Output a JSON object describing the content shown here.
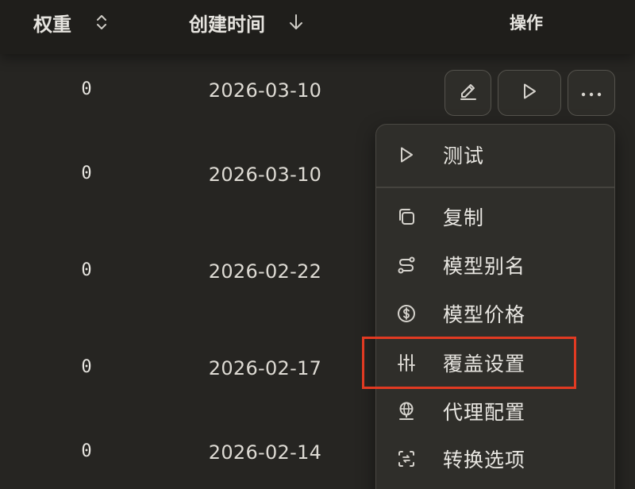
{
  "header": {
    "weight_label": "权重",
    "created_label": "创建时间",
    "ops_label": "操作"
  },
  "rows": [
    {
      "weight": "0",
      "created": "2026-03-10"
    },
    {
      "weight": "0",
      "created": "2026-03-10"
    },
    {
      "weight": "0",
      "created": "2026-02-22"
    },
    {
      "weight": "0",
      "created": "2026-02-17"
    },
    {
      "weight": "0",
      "created": "2026-02-14"
    }
  ],
  "actions": {
    "edit_icon": "pencil-icon",
    "test_icon": "play-icon",
    "more_icon": "more-horizontal-icon"
  },
  "menu": {
    "items": [
      {
        "label": "测试",
        "icon": "play-icon"
      },
      {
        "label": "复制",
        "icon": "copy-icon"
      },
      {
        "label": "模型别名",
        "icon": "route-icon"
      },
      {
        "label": "模型价格",
        "icon": "dollar-circle-icon"
      },
      {
        "label": "覆盖设置",
        "icon": "sliders-icon",
        "highlighted": true
      },
      {
        "label": "代理配置",
        "icon": "globe-pin-icon"
      },
      {
        "label": "转换选项",
        "icon": "convert-icon"
      }
    ]
  },
  "colors": {
    "background": "#262522",
    "header_bg": "#1f1e1b",
    "menu_bg": "#2f2e2a",
    "highlight": "#e23a22"
  }
}
